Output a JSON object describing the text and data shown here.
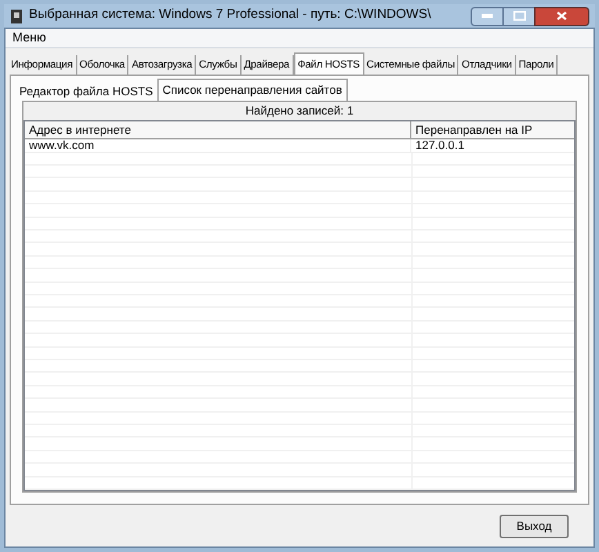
{
  "window": {
    "title": "Выбранная система: Windows 7 Professional - путь: C:\\WINDOWS\\"
  },
  "menu": [
    "Меню"
  ],
  "tabs": [
    {
      "label": "Информация",
      "selected": false
    },
    {
      "label": "Оболочка",
      "selected": false
    },
    {
      "label": "Автозагрузка",
      "selected": false
    },
    {
      "label": "Службы",
      "selected": false
    },
    {
      "label": "Драйвера",
      "selected": false
    },
    {
      "label": "Файл HOSTS",
      "selected": true
    },
    {
      "label": "Системные файлы",
      "selected": false
    },
    {
      "label": "Отладчики",
      "selected": false
    },
    {
      "label": "Пароли",
      "selected": false
    }
  ],
  "subtabs": [
    {
      "label": "Редактор файла HOSTS",
      "selected": false
    },
    {
      "label": "Список перенаправления сайтов",
      "selected": true
    }
  ],
  "found_label": "Найдено записей: 1",
  "table": {
    "columns": [
      "Адрес в интернете",
      "Перенаправлен на IP"
    ],
    "rows": [
      [
        "www.vk.com",
        "127.0.0.1"
      ]
    ]
  },
  "buttons": [
    "Выход"
  ]
}
